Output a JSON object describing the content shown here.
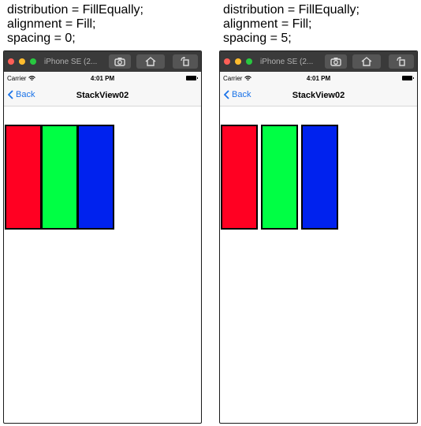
{
  "panels": [
    {
      "caption": [
        "distribution = FillEqually;",
        "alignment = Fill;",
        "spacing = 0;"
      ],
      "spacing": 0,
      "device_name": "iPhone SE (2...",
      "carrier": "Carrier",
      "time": "4:01 PM",
      "back_label": "Back",
      "title": "StackView02",
      "views": [
        {
          "name": "red-view",
          "color": "#ff0022"
        },
        {
          "name": "green-view",
          "color": "#00ff44"
        },
        {
          "name": "blue-view",
          "color": "#0022ee"
        }
      ]
    },
    {
      "caption": [
        "distribution = FillEqually;",
        "alignment = Fill;",
        "spacing = 5;"
      ],
      "spacing": 5,
      "device_name": "iPhone SE (2...",
      "carrier": "Carrier",
      "time": "4:01 PM",
      "back_label": "Back",
      "title": "StackView02",
      "views": [
        {
          "name": "red-view",
          "color": "#ff0022"
        },
        {
          "name": "green-view",
          "color": "#00ff44"
        },
        {
          "name": "blue-view",
          "color": "#0022ee"
        }
      ]
    }
  ],
  "icons": {
    "screenshot": "camera-icon",
    "home": "home-icon",
    "rotate": "rotate-icon",
    "wifi": "wifi-icon",
    "back": "chevron-left-icon"
  }
}
